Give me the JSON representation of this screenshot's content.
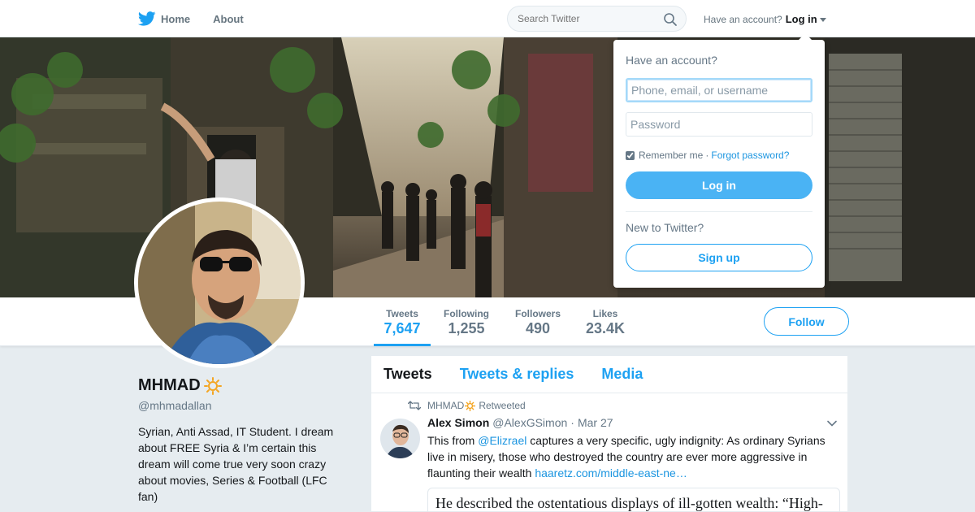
{
  "nav": {
    "home_label": "Home",
    "about_label": "About",
    "search_placeholder": "Search Twitter",
    "have_account_label": "Have an account?",
    "login_label": "Log in"
  },
  "login_dropdown": {
    "title": "Have an account?",
    "username_placeholder": "Phone, email, or username",
    "password_placeholder": "Password",
    "remember_label": "Remember me",
    "separator": "·",
    "forgot_label": "Forgot password?",
    "login_button": "Log in",
    "new_label": "New to Twitter?",
    "signup_button": "Sign up",
    "remember_checked": true
  },
  "profile": {
    "name": "MHMAD",
    "handle": "@mhmadallan",
    "bio": "Syrian, Anti Assad, IT Student. I dream about FREE Syria & I’m certain this dream will come true very soon crazy about movies, Series & Football (LFC fan)"
  },
  "stats": [
    {
      "label": "Tweets",
      "value": "7,647",
      "active": true
    },
    {
      "label": "Following",
      "value": "1,255",
      "active": false
    },
    {
      "label": "Followers",
      "value": "490",
      "active": false
    },
    {
      "label": "Likes",
      "value": "23.4K",
      "active": false
    }
  ],
  "follow_button": "Follow",
  "timeline": {
    "tabs": [
      "Tweets",
      "Tweets & replies",
      "Media"
    ],
    "active_tab": "Tweets"
  },
  "tweet": {
    "retweeter": "MHMAD",
    "retweeted_label": "Retweeted",
    "author_name": "Alex Simon",
    "author_handle": "@AlexGSimon",
    "dot": "·",
    "date": "Mar 27",
    "text_before": "This from ",
    "mention": "@Elizrael",
    "text_after": " captures a very specific, ugly indignity: As ordinary Syrians live in misery, those who destroyed the country are ever more aggressive in flaunting their wealth ",
    "link": "haaretz.com/middle-east-ne…",
    "quote": "He described the ostentatious displays of ill-gotten wealth: “High-"
  },
  "colors": {
    "accent": "#1da1f2",
    "link": "#1b95e0",
    "muted": "#657786",
    "background": "#e6ecf0"
  },
  "icons": [
    "twitter-bird-icon",
    "home-icon",
    "search-icon",
    "sun-emoji-icon",
    "retweet-icon",
    "chevron-down-icon"
  ]
}
